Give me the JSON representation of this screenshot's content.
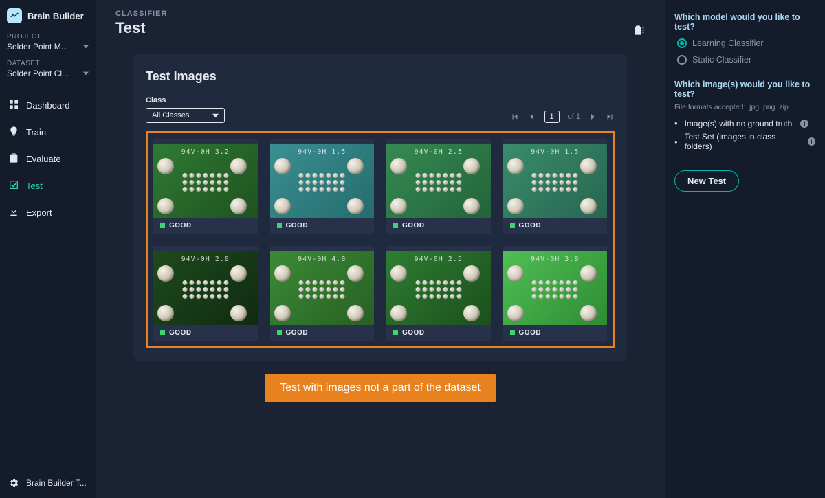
{
  "brand": {
    "name": "Brain Builder",
    "footer": "Brain Builder T..."
  },
  "sidebar": {
    "project_label": "PROJECT",
    "project_value": "Solder Point M...",
    "dataset_label": "DATASET",
    "dataset_value": "Solder Point Cl...",
    "nav": [
      {
        "label": "Dashboard",
        "icon": "grid"
      },
      {
        "label": "Train",
        "icon": "bulb"
      },
      {
        "label": "Evaluate",
        "icon": "clipboard"
      },
      {
        "label": "Test",
        "icon": "check-square",
        "active": true
      },
      {
        "label": "Export",
        "icon": "download"
      }
    ]
  },
  "header": {
    "crumb": "CLASSIFIER",
    "title": "Test"
  },
  "panel": {
    "title": "Test Images",
    "class_label": "Class",
    "class_value": "All Classes",
    "pager": {
      "page": "1",
      "of": "of 1"
    }
  },
  "gallery": [
    {
      "silk": "94V-0H 3.2",
      "label": "GOOD",
      "pcb1": "#2f7a34",
      "pcb2": "#1e521f"
    },
    {
      "silk": "94V-0H 1.5",
      "label": "GOOD",
      "pcb1": "#3a8f92",
      "pcb2": "#256c6e"
    },
    {
      "silk": "94V-0H 2.5",
      "label": "GOOD",
      "pcb1": "#368a52",
      "pcb2": "#23633a"
    },
    {
      "silk": "94V-0H 1.5",
      "label": "GOOD",
      "pcb1": "#3a8b6c",
      "pcb2": "#276651"
    },
    {
      "silk": "94V-0H 2.8",
      "label": "GOOD",
      "pcb1": "#1e4a1d",
      "pcb2": "#102b10"
    },
    {
      "silk": "94V-0H 4.8",
      "label": "GOOD",
      "pcb1": "#3c8a36",
      "pcb2": "#276023"
    },
    {
      "silk": "94V-0H 2.5",
      "label": "GOOD",
      "pcb1": "#2e7d32",
      "pcb2": "#1b4f1d"
    },
    {
      "silk": "94V-0H 3.8",
      "label": "GOOD",
      "pcb1": "#4fbf54",
      "pcb2": "#2e8c33"
    }
  ],
  "callout": "Test with images not a part of the dataset",
  "rail": {
    "q1": "Which model would you like to test?",
    "model_options": [
      {
        "label": "Learning Classifier",
        "selected": true
      },
      {
        "label": "Static Classifier",
        "selected": false
      }
    ],
    "q2": "Which image(s) would you like to test?",
    "sub": "File formats accepted: .jpg .png .zip",
    "bullets": [
      "Image(s) with no ground truth",
      "Test Set (images in class folders)"
    ],
    "new_test": "New Test"
  }
}
